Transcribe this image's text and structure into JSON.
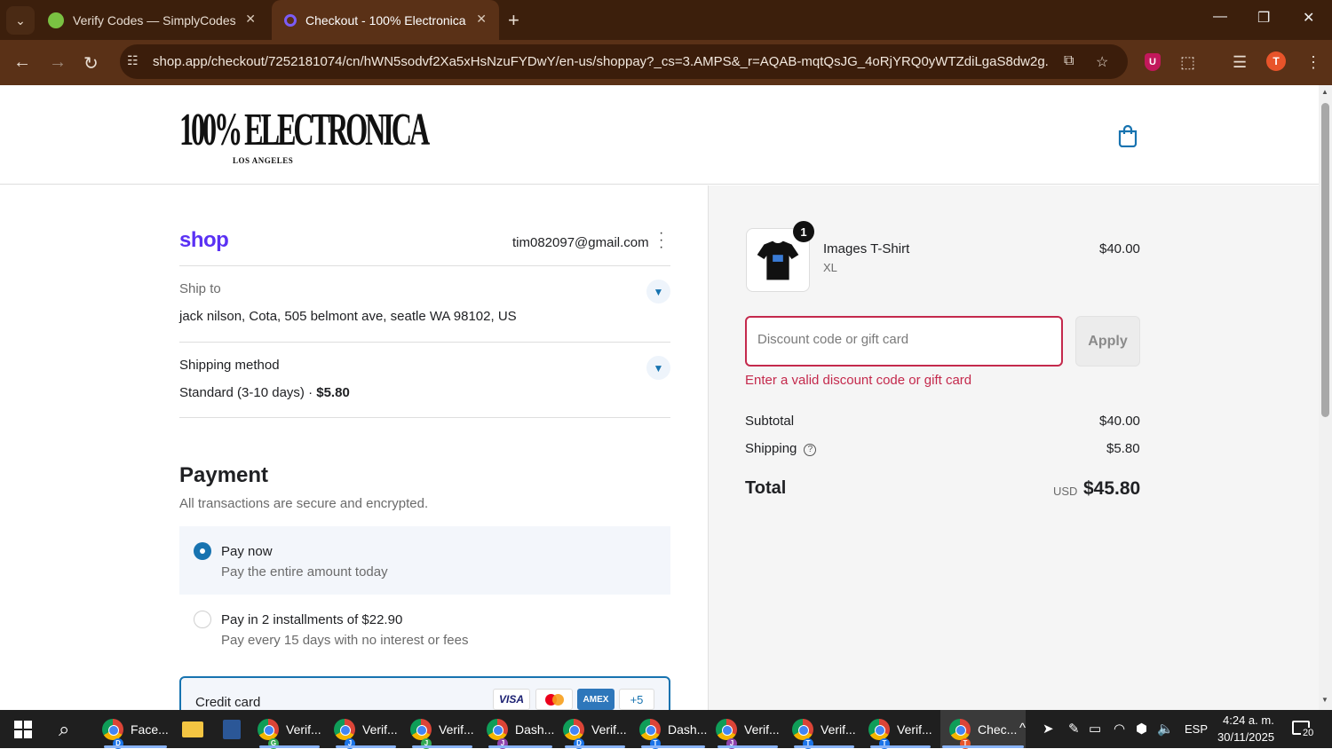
{
  "browser": {
    "tabs": [
      {
        "title": "Verify Codes — SimplyCodes",
        "active": false
      },
      {
        "title": "Checkout - 100% Electronica",
        "active": true
      }
    ],
    "url": "shop.app/checkout/7252181074/cn/hWN5sodvf2Xa5xHsNzuFYDwY/en-us/shoppay?_cs=3.AMPS&_r=AQAB-mqtQsJG_4oRjYRQ0yWTZdiLgaS8dw2g...",
    "profile_initial": "T",
    "accent": "#5a3117"
  },
  "store": {
    "logo_main": "100% ELECTRONICA",
    "logo_sub": "LOS ANGELES"
  },
  "checkout": {
    "shop_brand": "shop",
    "email": "tim082097@gmail.com",
    "ship_to_label": "Ship to",
    "ship_to_value": "jack nilson, Cota, 505 belmont ave, seatle WA 98102, US",
    "shipping_method_label": "Shipping method",
    "shipping_method_name": "Standard (3-10 days) · ",
    "shipping_method_price": "$5.80",
    "payment_title": "Payment",
    "payment_subtitle": "All transactions are secure and encrypted.",
    "options": [
      {
        "title": "Pay now",
        "subtitle": "Pay the entire amount today",
        "selected": true
      },
      {
        "title": "Pay in 2 installments of $22.90",
        "subtitle": "Pay every 15 days with no interest or fees",
        "selected": false
      }
    ],
    "credit_card_label": "Credit card",
    "card_brands": [
      "VISA",
      "mastercard",
      "AMEX",
      "+5"
    ]
  },
  "summary": {
    "item": {
      "name": "Images T-Shirt",
      "variant": "XL",
      "price": "$40.00",
      "quantity": "1"
    },
    "discount_placeholder": "Discount code or gift card",
    "apply_label": "Apply",
    "error": "Enter a valid discount code or gift card",
    "subtotal_label": "Subtotal",
    "subtotal_value": "$40.00",
    "shipping_label": "Shipping",
    "shipping_value": "$5.80",
    "total_label": "Total",
    "currency": "USD",
    "total_value": "$45.80"
  },
  "taskbar": {
    "apps": [
      {
        "label": "Face...",
        "badge": "D",
        "badge_color": "#1a73e8"
      },
      {
        "label": "Verif...",
        "badge": "G",
        "badge_color": "#34a853"
      },
      {
        "label": "Verif...",
        "badge": "J",
        "badge_color": "#1a73e8"
      },
      {
        "label": "Verif...",
        "badge": "J",
        "badge_color": "#34a853"
      },
      {
        "label": "Dash...",
        "badge": "J",
        "badge_color": "#8e44ad"
      },
      {
        "label": "Verif...",
        "badge": "D",
        "badge_color": "#1a73e8"
      },
      {
        "label": "Dash...",
        "badge": "T",
        "badge_color": "#1a73e8"
      },
      {
        "label": "Verif...",
        "badge": "J",
        "badge_color": "#8e44ad"
      },
      {
        "label": "Verif...",
        "badge": "T",
        "badge_color": "#1a73e8"
      },
      {
        "label": "Verif...",
        "badge": "T",
        "badge_color": "#1a73e8"
      },
      {
        "label": "Chec...",
        "badge": "T",
        "badge_color": "#e8542a"
      }
    ],
    "language": "ESP",
    "time": "4:24 a. m.",
    "date": "30/11/2025",
    "notification_count": "20"
  }
}
